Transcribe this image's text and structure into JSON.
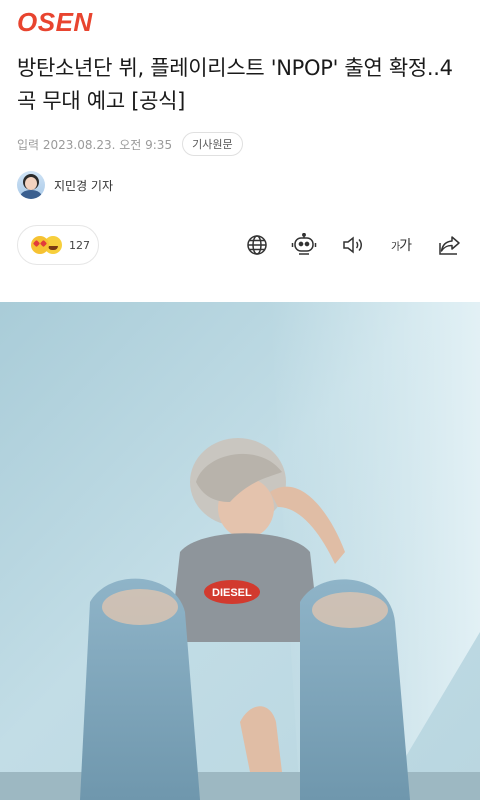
{
  "header": {
    "logo_text": "OSEN",
    "logo_color": "#e8442f"
  },
  "article": {
    "title": "방탄소년단 뷔, 플레이리스트 'NPOP' 출연 확정..4곡 무대 예고 [공식]",
    "date": "입력 2023.08.23. 오전 9:35",
    "original_button": "기사원문",
    "reporter": "지민경 기자"
  },
  "reactions": {
    "count": "127",
    "emojis": [
      "love-emoji",
      "laugh-emoji"
    ]
  },
  "toolbar": {
    "icons": [
      "globe-icon",
      "robot-icon",
      "speaker-icon",
      "font-size-icon",
      "share-icon"
    ],
    "font_size_label_small": "가",
    "font_size_label_large": "가"
  },
  "photo": {
    "description_icon": "article-photo"
  }
}
